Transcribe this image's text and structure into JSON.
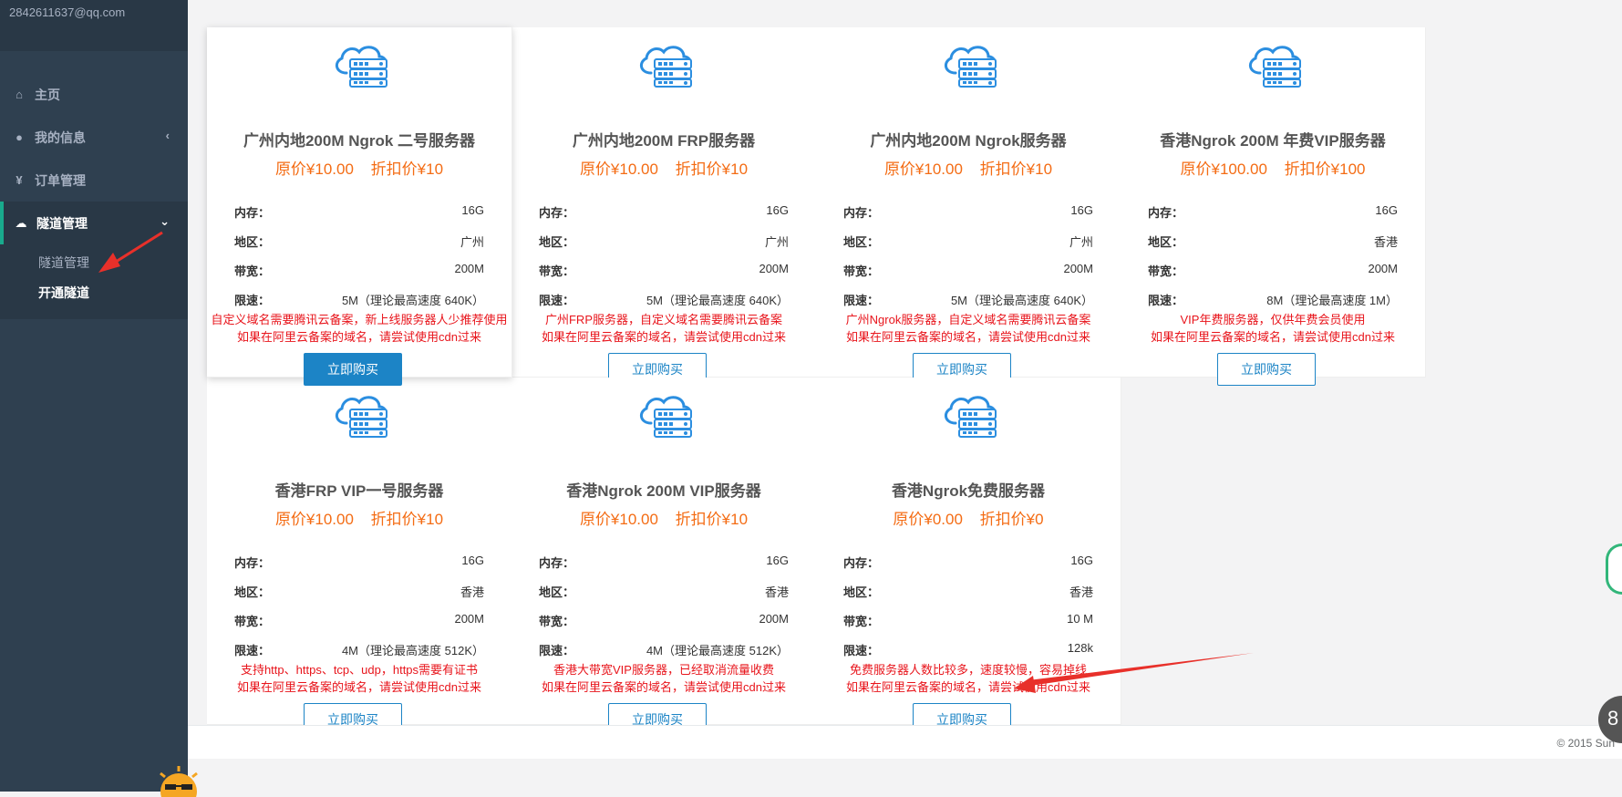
{
  "user": {
    "email": "2842611637@qq.com"
  },
  "nav": [
    {
      "label": "主页",
      "icon": "home-icon"
    },
    {
      "label": "我的信息",
      "icon": "user-icon",
      "arrow": "‹"
    },
    {
      "label": "订单管理",
      "icon": "yen-icon"
    },
    {
      "label": "隧道管理",
      "icon": "cloud-icon",
      "arrow": "⌄",
      "active": true,
      "children": [
        {
          "label": "隧道管理"
        },
        {
          "label": "开通隧道",
          "current": true
        }
      ]
    }
  ],
  "labels": {
    "memory": "内存：",
    "region": "地区：",
    "bandwidth": "带宽：",
    "speed": "限速：",
    "buy": "立即购买"
  },
  "cards": [
    {
      "title": "广州内地200M Ngrok 二号服务器",
      "orig": "原价¥10.00",
      "disc": "折扣价¥10",
      "memory": "16G",
      "region": "广州",
      "bandwidth": "200M",
      "speed": "5M（理论最高速度 640K）",
      "note1": "自定义域名需要腾讯云备案，新上线服务器人少推荐使用",
      "note2": "如果在阿里云备案的域名，请尝试使用cdn过来"
    },
    {
      "title": "广州内地200M FRP服务器",
      "orig": "原价¥10.00",
      "disc": "折扣价¥10",
      "memory": "16G",
      "region": "广州",
      "bandwidth": "200M",
      "speed": "5M（理论最高速度 640K）",
      "note1": "广州FRP服务器，自定义域名需要腾讯云备案",
      "note2": "如果在阿里云备案的域名，请尝试使用cdn过来"
    },
    {
      "title": "广州内地200M Ngrok服务器",
      "orig": "原价¥10.00",
      "disc": "折扣价¥10",
      "memory": "16G",
      "region": "广州",
      "bandwidth": "200M",
      "speed": "5M（理论最高速度 640K）",
      "note1": "广州Ngrok服务器，自定义域名需要腾讯云备案",
      "note2": "如果在阿里云备案的域名，请尝试使用cdn过来"
    },
    {
      "title": "香港Ngrok 200M 年费VIP服务器",
      "orig": "原价¥100.00",
      "disc": "折扣价¥100",
      "memory": "16G",
      "region": "香港",
      "bandwidth": "200M",
      "speed": "8M（理论最高速度 1M）",
      "note1": "VIP年费服务器，仅供年费会员使用",
      "note2": "如果在阿里云备案的域名，请尝试使用cdn过来"
    },
    {
      "title": "香港FRP VIP一号服务器",
      "orig": "原价¥10.00",
      "disc": "折扣价¥10",
      "memory": "16G",
      "region": "香港",
      "bandwidth": "200M",
      "speed": "4M（理论最高速度 512K）",
      "note1": "支持http、https、tcp、udp，https需要有证书",
      "note2": "如果在阿里云备案的域名，请尝试使用cdn过来"
    },
    {
      "title": "香港Ngrok 200M VIP服务器",
      "orig": "原价¥10.00",
      "disc": "折扣价¥10",
      "memory": "16G",
      "region": "香港",
      "bandwidth": "200M",
      "speed": "4M（理论最高速度 512K）",
      "note1": "香港大带宽VIP服务器，已经取消流量收费",
      "note2": "如果在阿里云备案的域名，请尝试使用cdn过来"
    },
    {
      "title": "香港Ngrok免费服务器",
      "orig": "原价¥0.00",
      "disc": "折扣价¥0",
      "memory": "16G",
      "region": "香港",
      "bandwidth": "10 M",
      "speed": "128k",
      "note1": "免费服务器人数比较多，速度较慢，容易掉线",
      "note2": "如果在阿里云备案的域名，请尝试使用cdn过来"
    }
  ],
  "footer": {
    "copyright": "© 2015 Sun"
  },
  "widgets": {
    "bottom_badge": "8"
  }
}
